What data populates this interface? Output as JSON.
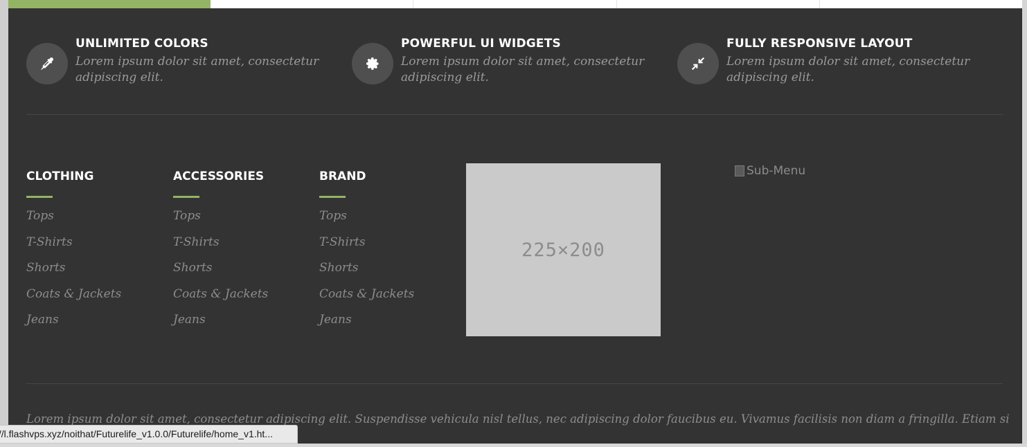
{
  "colors": {
    "panel_bg": "#333333",
    "accent": "#94b465",
    "icon_circle": "#4f4f4f",
    "muted_text": "#8d8d8d"
  },
  "top_tabs": [
    {
      "active": true
    },
    {
      "active": false
    },
    {
      "active": false
    },
    {
      "active": false
    },
    {
      "active": false
    }
  ],
  "features": [
    {
      "title": "UNLIMITED COLORS",
      "description": "Lorem ipsum dolor sit amet, consectetur adipiscing elit.",
      "icon": "eyedropper-icon"
    },
    {
      "title": "POWERFUL UI WIDGETS",
      "description": "Lorem ipsum dolor sit amet, consectetur adipiscing elit.",
      "icon": "gear-icon"
    },
    {
      "title": "FULLY RESPONSIVE LAYOUT",
      "description": "Lorem ipsum dolor sit amet, consectetur adipiscing elit.",
      "icon": "compress-icon"
    }
  ],
  "menus": [
    {
      "heading": "CLOTHING",
      "items": [
        "Tops",
        "T-Shirts",
        "Shorts",
        "Coats & Jackets",
        "Jeans"
      ]
    },
    {
      "heading": "ACCESSORIES",
      "items": [
        "Tops",
        "T-Shirts",
        "Shorts",
        "Coats & Jackets",
        "Jeans"
      ]
    },
    {
      "heading": "BRAND",
      "items": [
        "Tops",
        "T-Shirts",
        "Shorts",
        "Coats & Jackets",
        "Jeans"
      ]
    }
  ],
  "placeholder_image": {
    "label": "225×200"
  },
  "submenu_image": {
    "alt": "Sub-Menu",
    "icon": "broken-image-icon"
  },
  "footer": {
    "text": "Lorem ipsum dolor sit amet, consectetur adipiscing elit. Suspendisse vehicula nisl tellus, nec adipiscing dolor faucibus eu. Vivamus facilisis non diam a fringilla. Etiam sit amet"
  },
  "status_bar": {
    "url": "://l.flashvps.xyz/noithat/Futurelife_v1.0.0/Futurelife/home_v1.ht..."
  }
}
